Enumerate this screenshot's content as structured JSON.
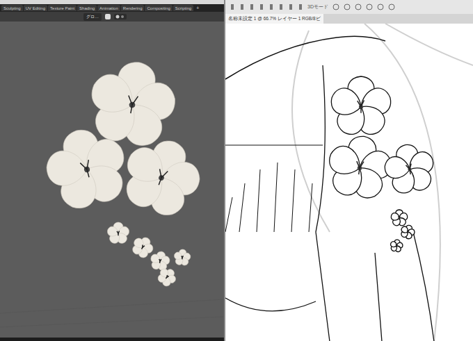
{
  "blender": {
    "workspace_tabs": [
      {
        "label": "Sculpting",
        "selected": false
      },
      {
        "label": "UV Editing",
        "selected": false
      },
      {
        "label": "Texture Paint",
        "selected": false
      },
      {
        "label": "Shading",
        "selected": false
      },
      {
        "label": "Animation",
        "selected": false
      },
      {
        "label": "Rendering",
        "selected": false
      },
      {
        "label": "Compositing",
        "selected": false
      },
      {
        "label": "Scripting",
        "selected": false
      }
    ],
    "add_tab": "+",
    "header": {
      "orientation": "グロ…"
    }
  },
  "clip_studio": {
    "toolbar": {
      "mode_label": "3Dモード"
    },
    "document_tab": "名称未設定 1 @ 66.7% レイヤー 1 RGB/8ビ"
  }
}
